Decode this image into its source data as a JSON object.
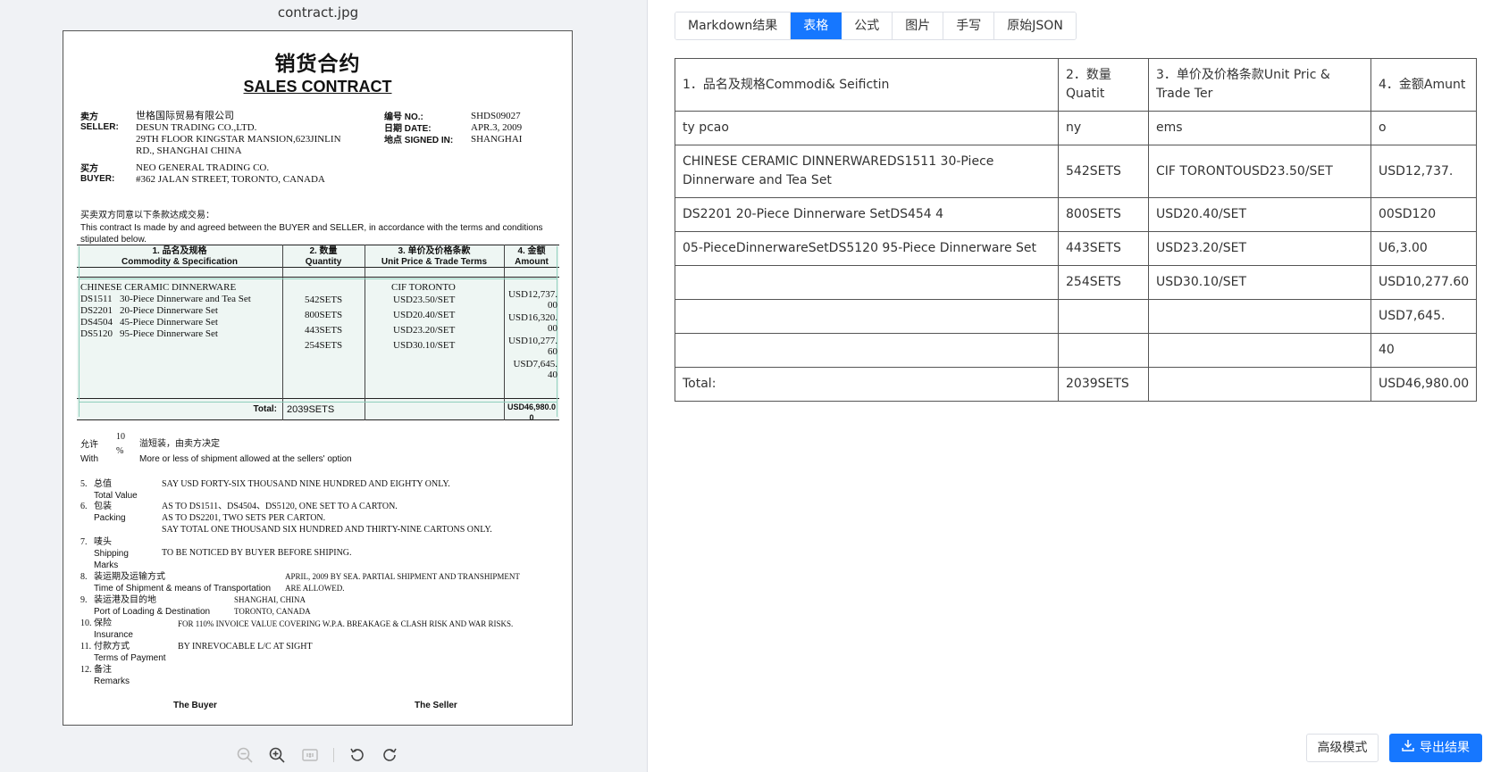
{
  "viewer": {
    "filename": "contract.jpg",
    "toolbar": [
      "zoom-out",
      "zoom-in",
      "fit-1-1",
      "rotate-left",
      "rotate-right"
    ]
  },
  "document": {
    "title_cn": "销货合约",
    "title_en": "SALES CONTRACT",
    "seller_label_cn": "卖方",
    "seller_label_en": "SELLER:",
    "seller_cn": "世格国际贸易有限公司",
    "seller_en": "DESUN TRADING CO.,LTD.",
    "seller_addr1": "29TH    FLOOR    KINGSTAR    MANSION,623JINLIN",
    "seller_addr2": "RD., SHANGHAI CHINA",
    "buyer_label_cn": "买方",
    "buyer_label_en": "BUYER:",
    "buyer_name": "NEO GENERAL TRADING CO.",
    "buyer_addr": "#362 JALAN STREET, TORONTO, CANADA",
    "no_label": "编号 NO.:",
    "no_value": "SHDS09027",
    "date_label": "日期 DATE:",
    "date_value": "APR.3, 2009",
    "signed_label": "地点 SIGNED IN:",
    "signed_value": "SHANGHAI",
    "intro_cn": "买卖双方同意以下条款达成交易：",
    "intro_en1": "This contract Is made by and agreed between the BUYER and SELLER, in accordance with the terms and conditions",
    "intro_en2": "stipulated below.",
    "th1_cn": "1. 品名及规格",
    "th1_en": "Commodity & Specification",
    "th2_cn": "2. 数量",
    "th2_en": "Quantity",
    "th3_cn": "3. 单价及价格条款",
    "th3_en": "Unit Price & Trade Terms",
    "th4_cn": "4. 金额",
    "th4_en": "Amount",
    "commodity_head": "CHINESE CERAMIC DINNERWARE",
    "items": [
      {
        "code": "DS1511",
        "desc": "30-Piece Dinnerware and Tea Set",
        "qty": "542SETS",
        "price": "USD23.50/SET"
      },
      {
        "code": "DS2201",
        "desc": "20-Piece Dinnerware Set",
        "qty": "800SETS",
        "price": "USD20.40/SET"
      },
      {
        "code": "DS4504",
        "desc": "45-Piece Dinnerware Set",
        "qty": "443SETS",
        "price": "USD23.20/SET"
      },
      {
        "code": "DS5120",
        "desc": "95-Piece Dinnerware Set",
        "qty": "254SETS",
        "price": "USD30.10/SET"
      }
    ],
    "price_terms": "CIF TORONTO",
    "amount_lines": [
      "USD12,737.",
      "00",
      "USD16,320.",
      "00",
      "USD10,277.",
      "60",
      "USD7,645.",
      "40"
    ],
    "total_label": "Total:",
    "total_qty": "2039SETS",
    "total_amount_1": "USD46,980.0",
    "total_amount_2": "0",
    "allow_cn": "允许",
    "allow_pct": "10",
    "allow_pct_sign": "%",
    "allow_note_cn": "溢短装，由卖方决定",
    "allow_en": "With",
    "allow_note_en": "More or less of shipment allowed at the sellers' option",
    "clauses": [
      {
        "num": "5.",
        "cn": "总值",
        "en": "Total Value",
        "text": [
          "SAY USD FORTY-SIX THOUSAND NINE HUNDRED AND EIGHTY ONLY."
        ]
      },
      {
        "num": "6.",
        "cn": "包装",
        "en": "Packing",
        "text": [
          "AS TO DS1511、DS4504、DS5120, ONE SET TO A CARTON.",
          "AS TO DS2201, TWO SETS PER CARTON.",
          "SAY TOTAL ONE THOUSAND SIX HUNDRED AND THIRTY-NINE CARTONS ONLY."
        ]
      },
      {
        "num": "7.",
        "cn": "唛头",
        "en": "Shipping",
        "en2": "Marks",
        "text": [
          "TO BE NOTICED BY BUYER BEFORE SHIPING."
        ]
      },
      {
        "num": "8.",
        "cn": "装运期及运输方式",
        "en": "Time of Shipment & means of Transportation",
        "text": [
          "APRIL, 2009 BY SEA. PARTIAL SHIPMENT AND TRANSHIPMENT",
          "ARE ALLOWED."
        ]
      },
      {
        "num": "9.",
        "cn": "装运港及目的地",
        "en": "Port of Loading & Destination",
        "text": [
          "SHANGHAI, CHINA",
          "TORONTO, CANADA"
        ]
      },
      {
        "num": "10.",
        "cn": "保险",
        "en": "Insurance",
        "text": [
          "FOR 110% INVOICE VALUE COVERING W.P.A. BREAKAGE & CLASH RISK AND WAR RISKS."
        ]
      },
      {
        "num": "11.",
        "cn": "付款方式",
        "en": "Terms of Payment",
        "text": [
          "BY INREVOCABLE L/C AT SIGHT"
        ]
      },
      {
        "num": "12.",
        "cn": "备注",
        "en": "Remarks",
        "text": []
      }
    ],
    "buyer_sign": "The Buyer",
    "seller_sign": "The Seller"
  },
  "tabs": [
    {
      "label": "Markdown结果",
      "active": false
    },
    {
      "label": "表格",
      "active": true
    },
    {
      "label": "公式",
      "active": false
    },
    {
      "label": "图片",
      "active": false
    },
    {
      "label": "手写",
      "active": false
    },
    {
      "label": "原始JSON",
      "active": false
    }
  ],
  "result_table": {
    "rows": [
      [
        "1．品名及规格Commodi& Seifictin",
        "2．数量Quatit",
        "3．单价及价格条款Unit Pric & Trade Ter",
        "4．金额Amunt"
      ],
      [
        "ty pcao",
        "ny",
        "ems",
        "o"
      ],
      [
        "CHINESE CERAMIC DINNERWAREDS1511 30-Piece Dinnerware and Tea Set",
        "542SETS",
        "CIF TORONTOUSD23.50/SET",
        "USD12,737."
      ],
      [
        "DS2201 20-Piece Dinnerware SetDS454 4",
        "800SETS",
        "USD20.40/SET",
        "00SD120"
      ],
      [
        "05-PieceDinnerwareSetDS5120 95-Piece Dinnerware Set",
        "443SETS",
        "USD23.20/SET",
        "U6,3.00"
      ],
      [
        "",
        "254SETS",
        "USD30.10/SET",
        "USD10,277.60"
      ],
      [
        "",
        "",
        "",
        "USD7,645."
      ],
      [
        "",
        "",
        "",
        "40"
      ],
      [
        "Total:",
        "2039SETS",
        "",
        "USD46,980.00"
      ]
    ]
  },
  "actions": {
    "advanced": "高级模式",
    "export": "导出结果"
  },
  "colors": {
    "accent": "#1677ff",
    "table_highlight": "#eef6f3"
  }
}
